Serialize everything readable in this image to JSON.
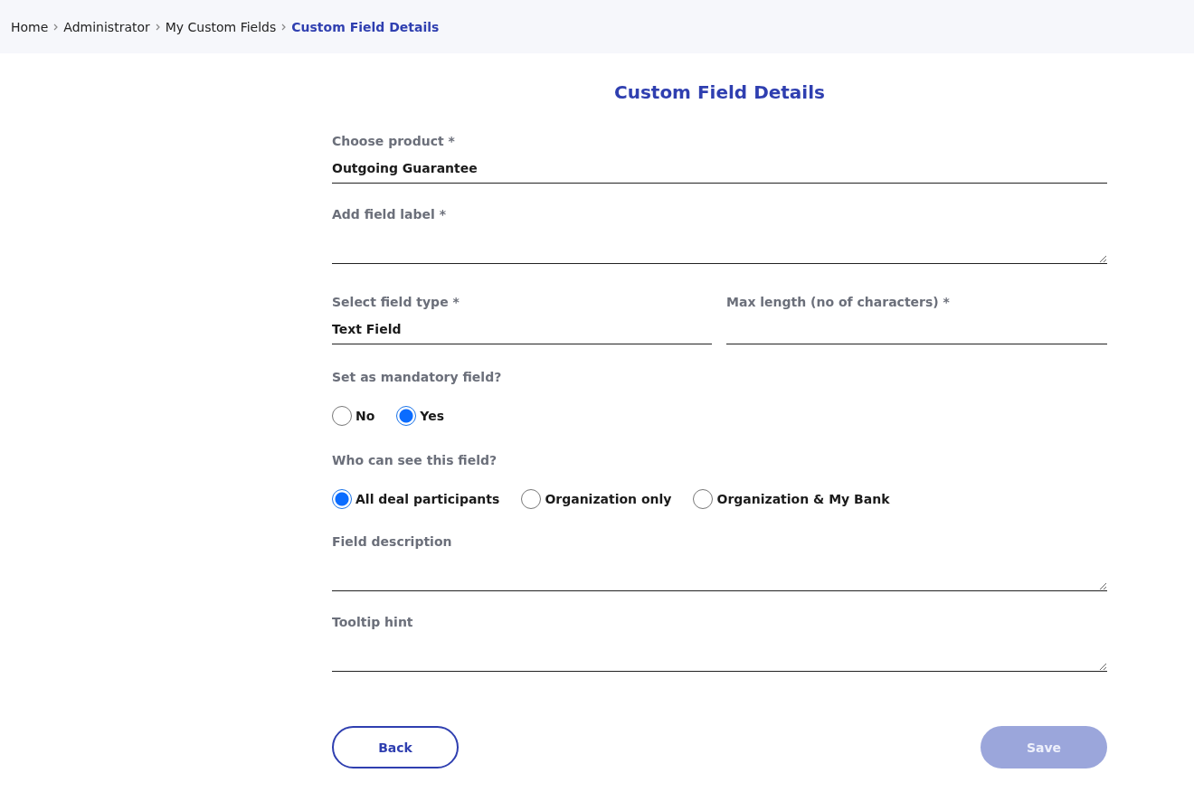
{
  "breadcrumb": [
    {
      "label": "Home",
      "current": false
    },
    {
      "label": "Administrator",
      "current": false
    },
    {
      "label": "My Custom Fields",
      "current": false
    },
    {
      "label": "Custom Field Details",
      "current": true
    }
  ],
  "title": "Custom Field Details",
  "product": {
    "label": "Choose product *",
    "value": "Outgoing Guarantee"
  },
  "field_label": {
    "label": "Add field label *"
  },
  "field_type": {
    "label": "Select field type *",
    "value": "Text Field"
  },
  "max_length": {
    "label": "Max length (no of characters) *"
  },
  "mandatory": {
    "question": "Set as mandatory field?",
    "options": [
      {
        "label": "No",
        "selected": false
      },
      {
        "label": "Yes",
        "selected": true
      }
    ]
  },
  "visibility": {
    "question": "Who can see this field?",
    "options": [
      {
        "label": "All deal participants",
        "selected": true
      },
      {
        "label": "Organization only",
        "selected": false
      },
      {
        "label": "Organization & My Bank",
        "selected": false
      }
    ]
  },
  "description": {
    "label": "Field description"
  },
  "tooltip": {
    "label": "Tooltip hint"
  },
  "buttons": {
    "back": {
      "label": "Back"
    },
    "save": {
      "label": "Save",
      "disabled": true
    }
  }
}
